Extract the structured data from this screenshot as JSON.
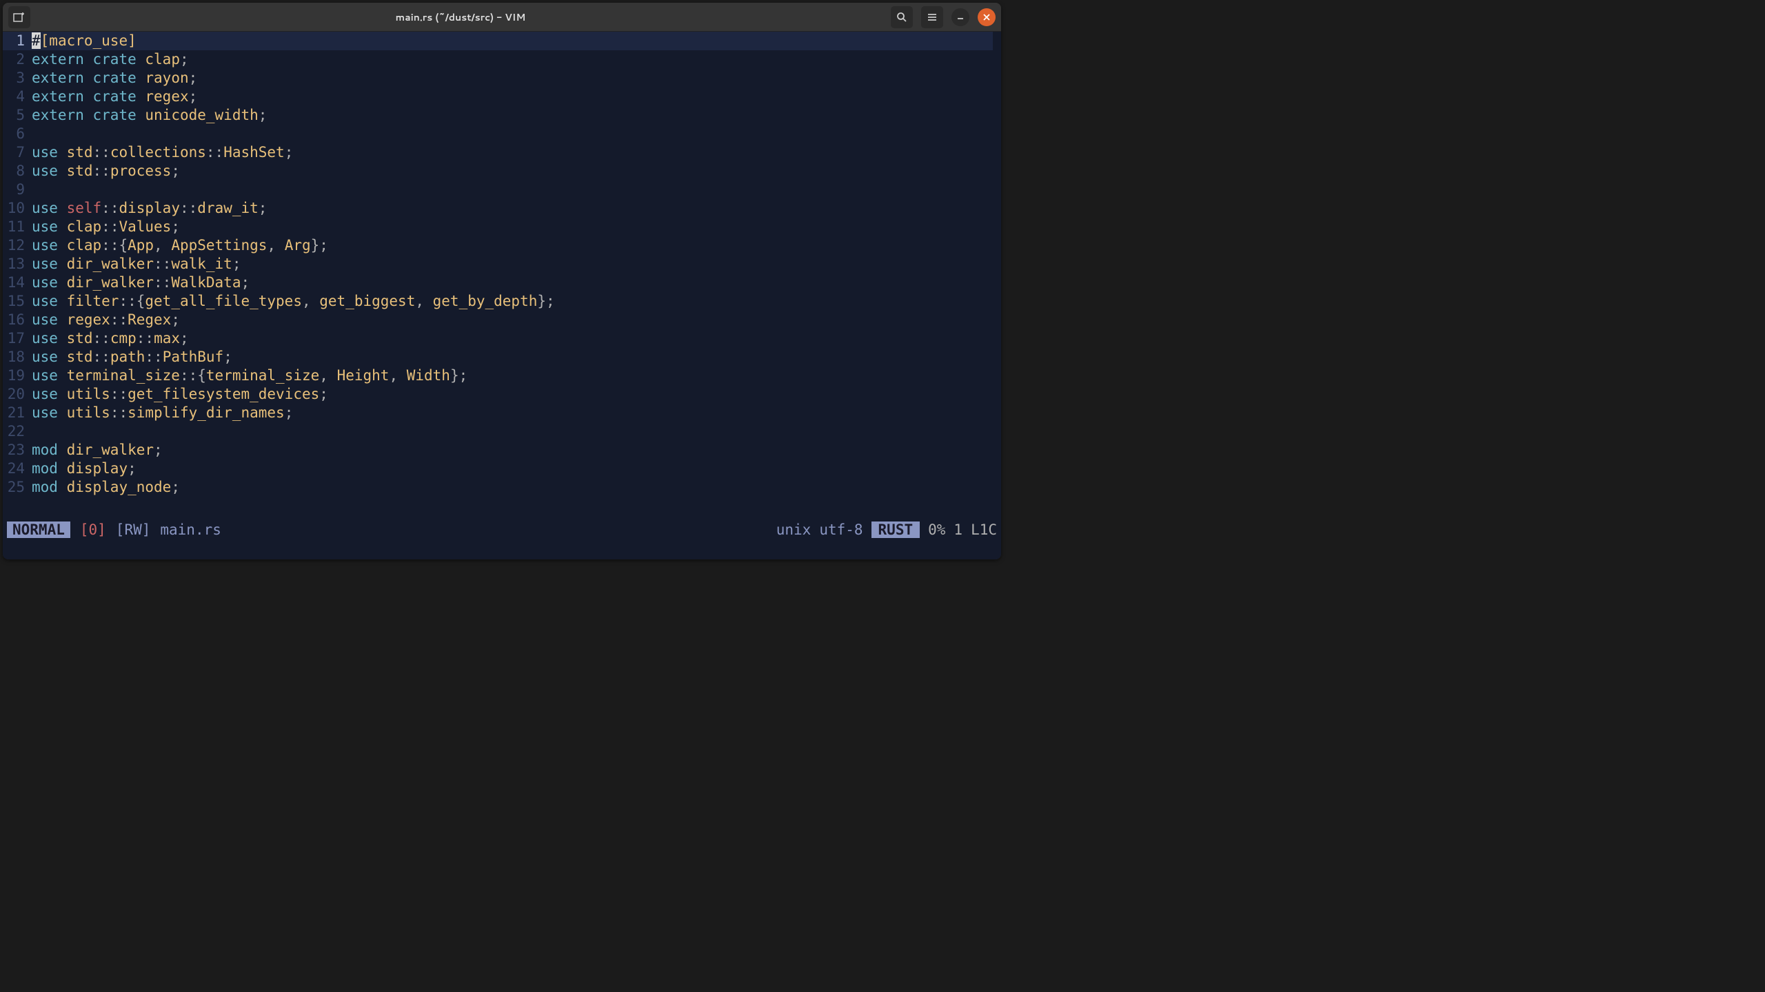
{
  "window": {
    "title": "main.rs (~/dust/src) - VIM"
  },
  "statusline": {
    "mode": "NORMAL",
    "register": "[0]",
    "rw": "[RW]",
    "filename": "main.rs",
    "fileformat": "unix",
    "encoding": "utf-8",
    "lang": "RUST",
    "percent": "0%",
    "linecol": "1",
    "col": "L1C"
  },
  "code": {
    "lines": [
      {
        "n": 1,
        "tokens": [
          [
            "cursor",
            "#"
          ],
          [
            "attr",
            "[macro_use]"
          ]
        ]
      },
      {
        "n": 2,
        "tokens": [
          [
            "kw-extern",
            "extern"
          ],
          [
            "p",
            " "
          ],
          [
            "kw-crate",
            "crate"
          ],
          [
            "p",
            " "
          ],
          [
            "ident",
            "clap"
          ],
          [
            "p",
            ";"
          ]
        ]
      },
      {
        "n": 3,
        "tokens": [
          [
            "kw-extern",
            "extern"
          ],
          [
            "p",
            " "
          ],
          [
            "kw-crate",
            "crate"
          ],
          [
            "p",
            " "
          ],
          [
            "ident",
            "rayon"
          ],
          [
            "p",
            ";"
          ]
        ]
      },
      {
        "n": 4,
        "tokens": [
          [
            "kw-extern",
            "extern"
          ],
          [
            "p",
            " "
          ],
          [
            "kw-crate",
            "crate"
          ],
          [
            "p",
            " "
          ],
          [
            "ident",
            "regex"
          ],
          [
            "p",
            ";"
          ]
        ]
      },
      {
        "n": 5,
        "tokens": [
          [
            "kw-extern",
            "extern"
          ],
          [
            "p",
            " "
          ],
          [
            "kw-crate",
            "crate"
          ],
          [
            "p",
            " "
          ],
          [
            "ident",
            "unicode_width"
          ],
          [
            "p",
            ";"
          ]
        ]
      },
      {
        "n": 6,
        "tokens": []
      },
      {
        "n": 7,
        "tokens": [
          [
            "kw-use",
            "use"
          ],
          [
            "p",
            " "
          ],
          [
            "ident",
            "std"
          ],
          [
            "p",
            "::"
          ],
          [
            "ident",
            "collections"
          ],
          [
            "p",
            "::"
          ],
          [
            "ident",
            "HashSet"
          ],
          [
            "p",
            ";"
          ]
        ]
      },
      {
        "n": 8,
        "tokens": [
          [
            "kw-use",
            "use"
          ],
          [
            "p",
            " "
          ],
          [
            "ident",
            "std"
          ],
          [
            "p",
            "::"
          ],
          [
            "ident",
            "process"
          ],
          [
            "p",
            ";"
          ]
        ]
      },
      {
        "n": 9,
        "tokens": []
      },
      {
        "n": 10,
        "tokens": [
          [
            "kw-use",
            "use"
          ],
          [
            "p",
            " "
          ],
          [
            "kw-self",
            "self"
          ],
          [
            "p",
            "::"
          ],
          [
            "ident",
            "display"
          ],
          [
            "p",
            "::"
          ],
          [
            "ident",
            "draw_it"
          ],
          [
            "p",
            ";"
          ]
        ]
      },
      {
        "n": 11,
        "tokens": [
          [
            "kw-use",
            "use"
          ],
          [
            "p",
            " "
          ],
          [
            "ident",
            "clap"
          ],
          [
            "p",
            "::"
          ],
          [
            "ident",
            "Values"
          ],
          [
            "p",
            ";"
          ]
        ]
      },
      {
        "n": 12,
        "tokens": [
          [
            "kw-use",
            "use"
          ],
          [
            "p",
            " "
          ],
          [
            "ident",
            "clap"
          ],
          [
            "p",
            "::{"
          ],
          [
            "ident",
            "App"
          ],
          [
            "p",
            ", "
          ],
          [
            "ident",
            "AppSettings"
          ],
          [
            "p",
            ", "
          ],
          [
            "ident",
            "Arg"
          ],
          [
            "p",
            "};"
          ]
        ]
      },
      {
        "n": 13,
        "tokens": [
          [
            "kw-use",
            "use"
          ],
          [
            "p",
            " "
          ],
          [
            "ident",
            "dir_walker"
          ],
          [
            "p",
            "::"
          ],
          [
            "ident",
            "walk_it"
          ],
          [
            "p",
            ";"
          ]
        ]
      },
      {
        "n": 14,
        "tokens": [
          [
            "kw-use",
            "use"
          ],
          [
            "p",
            " "
          ],
          [
            "ident",
            "dir_walker"
          ],
          [
            "p",
            "::"
          ],
          [
            "ident",
            "WalkData"
          ],
          [
            "p",
            ";"
          ]
        ]
      },
      {
        "n": 15,
        "tokens": [
          [
            "kw-use",
            "use"
          ],
          [
            "p",
            " "
          ],
          [
            "ident",
            "filter"
          ],
          [
            "p",
            "::{"
          ],
          [
            "ident",
            "get_all_file_types"
          ],
          [
            "p",
            ", "
          ],
          [
            "ident",
            "get_biggest"
          ],
          [
            "p",
            ", "
          ],
          [
            "ident",
            "get_by_depth"
          ],
          [
            "p",
            "};"
          ]
        ]
      },
      {
        "n": 16,
        "tokens": [
          [
            "kw-use",
            "use"
          ],
          [
            "p",
            " "
          ],
          [
            "ident",
            "regex"
          ],
          [
            "p",
            "::"
          ],
          [
            "ident",
            "Regex"
          ],
          [
            "p",
            ";"
          ]
        ]
      },
      {
        "n": 17,
        "tokens": [
          [
            "kw-use",
            "use"
          ],
          [
            "p",
            " "
          ],
          [
            "ident",
            "std"
          ],
          [
            "p",
            "::"
          ],
          [
            "ident",
            "cmp"
          ],
          [
            "p",
            "::"
          ],
          [
            "ident",
            "max"
          ],
          [
            "p",
            ";"
          ]
        ]
      },
      {
        "n": 18,
        "tokens": [
          [
            "kw-use",
            "use"
          ],
          [
            "p",
            " "
          ],
          [
            "ident",
            "std"
          ],
          [
            "p",
            "::"
          ],
          [
            "ident",
            "path"
          ],
          [
            "p",
            "::"
          ],
          [
            "ident",
            "PathBuf"
          ],
          [
            "p",
            ";"
          ]
        ]
      },
      {
        "n": 19,
        "tokens": [
          [
            "kw-use",
            "use"
          ],
          [
            "p",
            " "
          ],
          [
            "ident",
            "terminal_size"
          ],
          [
            "p",
            "::{"
          ],
          [
            "ident",
            "terminal_size"
          ],
          [
            "p",
            ", "
          ],
          [
            "ident",
            "Height"
          ],
          [
            "p",
            ", "
          ],
          [
            "ident",
            "Width"
          ],
          [
            "p",
            "};"
          ]
        ]
      },
      {
        "n": 20,
        "tokens": [
          [
            "kw-use",
            "use"
          ],
          [
            "p",
            " "
          ],
          [
            "ident",
            "utils"
          ],
          [
            "p",
            "::"
          ],
          [
            "ident",
            "get_filesystem_devices"
          ],
          [
            "p",
            ";"
          ]
        ]
      },
      {
        "n": 21,
        "tokens": [
          [
            "kw-use",
            "use"
          ],
          [
            "p",
            " "
          ],
          [
            "ident",
            "utils"
          ],
          [
            "p",
            "::"
          ],
          [
            "ident",
            "simplify_dir_names"
          ],
          [
            "p",
            ";"
          ]
        ]
      },
      {
        "n": 22,
        "tokens": []
      },
      {
        "n": 23,
        "tokens": [
          [
            "kw-mod",
            "mod"
          ],
          [
            "p",
            " "
          ],
          [
            "ident",
            "dir_walker"
          ],
          [
            "p",
            ";"
          ]
        ]
      },
      {
        "n": 24,
        "tokens": [
          [
            "kw-mod",
            "mod"
          ],
          [
            "p",
            " "
          ],
          [
            "ident",
            "display"
          ],
          [
            "p",
            ";"
          ]
        ]
      },
      {
        "n": 25,
        "tokens": [
          [
            "kw-mod",
            "mod"
          ],
          [
            "p",
            " "
          ],
          [
            "ident",
            "display_node"
          ],
          [
            "p",
            ";"
          ]
        ]
      }
    ]
  }
}
